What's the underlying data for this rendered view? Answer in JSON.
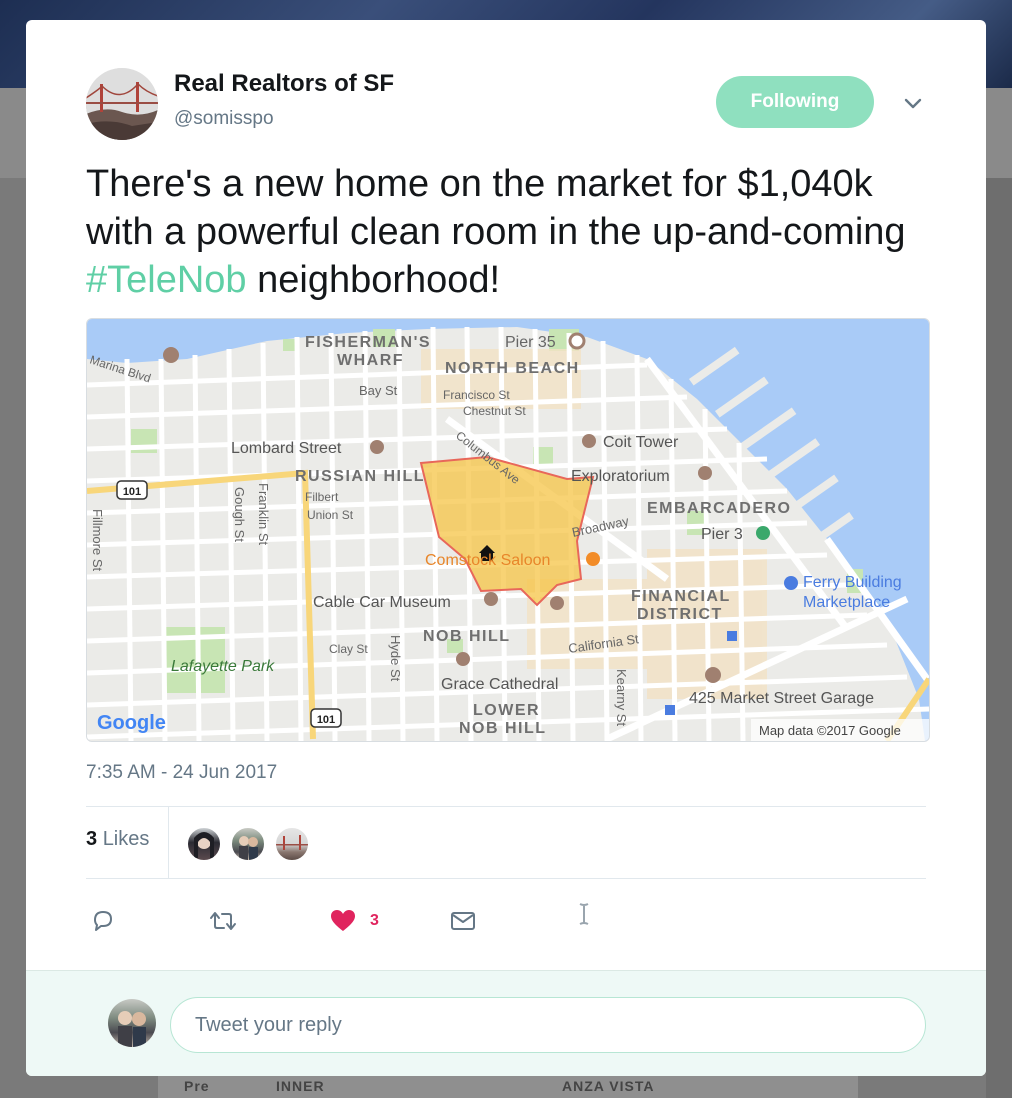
{
  "tweet": {
    "display_name": "Real Realtors of SF",
    "handle": "@somisspo",
    "follow_label": "Following",
    "text_before": "There's a new home on the market for $1,040k with a powerful clean room in the up-and-coming ",
    "hashtag": "#TeleNob",
    "text_after": " neighborhood!",
    "timestamp": "7:35 AM - 24 Jun 2017",
    "likes_count": "3",
    "likes_label": "Likes",
    "like_action_count": "3"
  },
  "map": {
    "labels": {
      "fishermans_wharf_1": "FISHERMAN'S",
      "fishermans_wharf_2": "WHARF",
      "pier35": "Pier 35",
      "north_beach": "NORTH BEACH",
      "marina_blvd": "Marina Blvd",
      "bay_st": "Bay St",
      "francisco_st": "Francisco St",
      "chestnut_st": "Chestnut St",
      "lombard_street": "Lombard Street",
      "coit_tower": "Coit Tower",
      "columbus_ave": "Columbus Ave",
      "russian_hill": "RUSSIAN HILL",
      "exploratorium": "Exploratorium",
      "filbert": "Filbert",
      "union_st": "Union St",
      "embarcadero": "EMBARCADERO",
      "broadway": "Broadway",
      "pier3": "Pier 3",
      "gough_st": "Gough St",
      "franklin_st": "Franklin St",
      "fillmore_st": "Fillmore St",
      "comstock_saloon": "Comstock Saloon",
      "ferry_building_1": "Ferry Building",
      "ferry_building_2": "Marketplace",
      "financial_1": "FINANCIAL",
      "financial_2": "DISTRICT",
      "cable_car_museum": "Cable Car Museum",
      "nob_hill": "NOB HILL",
      "california_st": "California St",
      "clay_st": "Clay St",
      "hyde_st": "Hyde St",
      "lafayette_park": "Lafayette Park",
      "grace_cathedral": "Grace Cathedral",
      "kearny_st": "Kearny St",
      "garage": "425 Market Street Garage",
      "lower_nob_hill_1": "LOWER",
      "lower_nob_hill_2": "NOB HILL",
      "hwy101": "101",
      "google": "Google",
      "map_data": "Map data ©2017 Google"
    },
    "colors": {
      "water": "#a9cbf7",
      "land": "#ebebe8",
      "highway": "#f8d67a",
      "highlight_fill": "#f6c445",
      "highlight_stroke": "#e8675a",
      "park": "#c8e5b4"
    }
  },
  "reply": {
    "placeholder": "Tweet your reply"
  },
  "background": {
    "inner_label": "INNER",
    "anza_vista_label": "ANZA VISTA",
    "pre_label": "Pre"
  },
  "colors": {
    "accent": "#5fcfa5",
    "follow_bg": "#8fe0bf",
    "like_red": "#e0245e",
    "text_primary": "#14171a",
    "text_secondary": "#657786"
  }
}
